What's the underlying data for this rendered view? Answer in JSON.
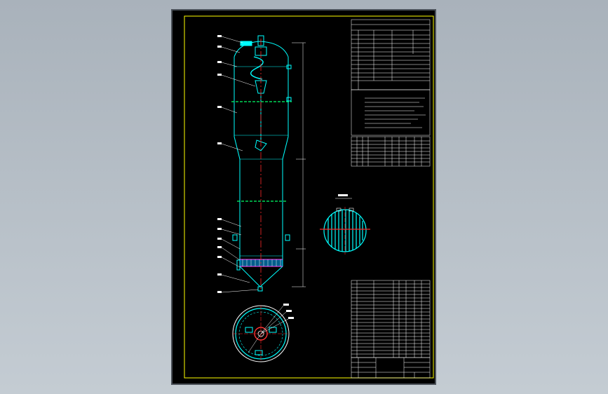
{
  "colors": {
    "background": "#b7c0c8",
    "sheet": "#000000",
    "frame": "#ffff00",
    "vessel_outline": "#00ffff",
    "center_line": "#ff2a2a",
    "flange": "#00ff66",
    "leader": "#ffffff",
    "table_lines": "#ffffff"
  },
  "icons": [
    "column-vessel-icon",
    "section-view-icon",
    "bottom-view-icon",
    "cyclone-icon"
  ],
  "title_block": {
    "title": "",
    "scale": "",
    "sheet": ""
  },
  "tables": {
    "design_data_rows": 14,
    "nozzle_rows": 8,
    "parts_rows": 22
  }
}
